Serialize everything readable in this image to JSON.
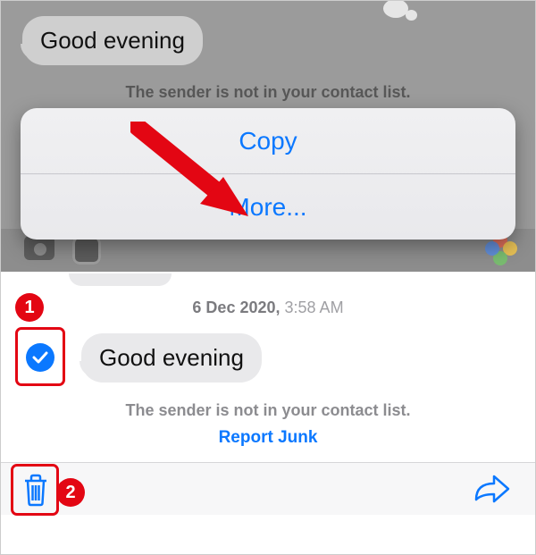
{
  "upper": {
    "bubble_text": "Good evening",
    "notice": "The sender is not in your contact list."
  },
  "action_sheet": {
    "copy_label": "Copy",
    "more_label": "More..."
  },
  "lower": {
    "timestamp_date": "6 Dec 2020,",
    "timestamp_time": "3:58 AM",
    "bubble_text": "Good evening",
    "notice": "The sender is not in your contact list.",
    "report_label": "Report Junk"
  },
  "annotations": {
    "badge1": "1",
    "badge2": "2"
  }
}
